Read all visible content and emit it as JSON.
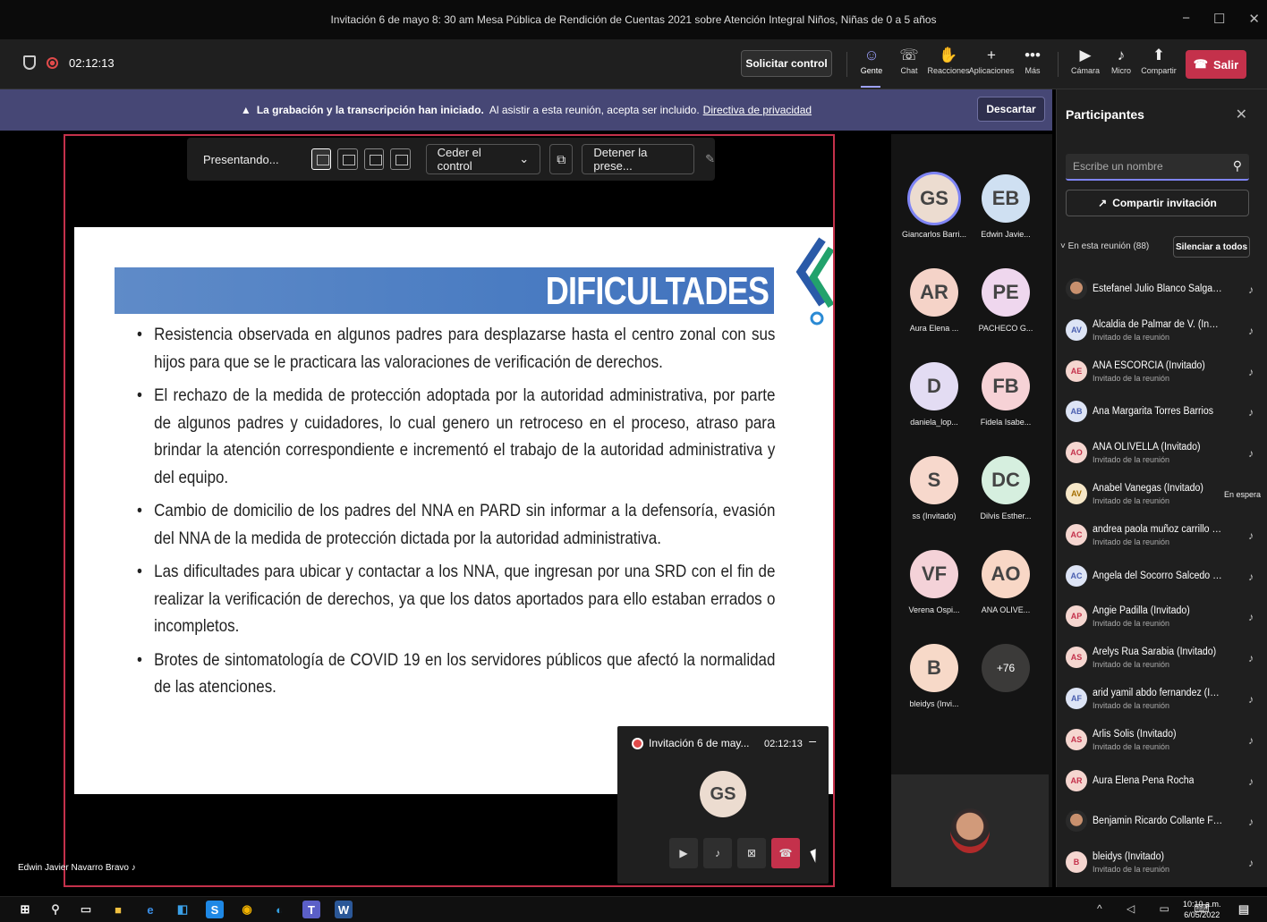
{
  "window": {
    "title": "Invitación 6 de mayo 8: 30 am Mesa Pública de Rendición de Cuentas 2021 sobre Atención Integral Niños, Niñas de 0 a 5 años"
  },
  "toolbar": {
    "timer": "02:12:13",
    "request_control": "Solicitar control",
    "people": "Gente",
    "chat": "Chat",
    "reactions": "Reacciones",
    "apps": "Aplicaciones",
    "more": "Más",
    "camera": "Cámara",
    "mic": "Micro",
    "share": "Compartir",
    "leave": "Salir"
  },
  "banner": {
    "bold": "La grabación y la transcripción han iniciado.",
    "text": "Al asistir a esta reunión, acepta ser incluido.",
    "link": "Directiva de privacidad",
    "dismiss": "Descartar"
  },
  "presenter_bar": {
    "label": "Presentando...",
    "give_control": "Ceder el control",
    "stop": "Detener la prese..."
  },
  "slide": {
    "title": "DIFICULTADES",
    "bullets": [
      "Resistencia observada en algunos padres para desplazarse hasta el centro zonal con sus hijos para que se le practicara las valoraciones de verificación de derechos.",
      "El rechazo de la medida de protección adoptada por la autoridad administrativa, por parte de algunos padres y cuidadores, lo cual genero un retroceso en el proceso, atraso para brindar la atención correspondiente e incrementó el trabajo de la autoridad administrativa y del equipo.",
      "Cambio de domicilio de los padres del NNA en PARD sin informar a la defensoría, evasión del NNA de la medida de protección dictada por la autoridad administrativa.",
      "Las dificultades para ubicar y contactar a los NNA, que ingresan por una SRD con el fin de realizar la verificación de derechos, ya que los datos aportados para ello estaban errados o incompletos.",
      "Brotes de sintomatología de COVID 19 en los servidores públicos que afectó la normalidad de las atenciones."
    ]
  },
  "presenter_name": "Edwin Javier Navarro Bravo",
  "mini": {
    "title": "Invitación 6 de may...",
    "time": "02:12:13",
    "avatar": "GS"
  },
  "gallery": [
    {
      "initials": "GS",
      "name": "Giancarlos Barri...",
      "color": "#ecdcd0"
    },
    {
      "initials": "EB",
      "name": "Edwin Javie...",
      "color": "#cfe0f2"
    },
    {
      "initials": "AR",
      "name": "Aura Elena ...",
      "color": "#f5d3c8"
    },
    {
      "initials": "PE",
      "name": "PACHECO G...",
      "color": "#efd7ee"
    },
    {
      "initials": "D",
      "name": "daniela_lop...",
      "color": "#e3dcf3"
    },
    {
      "initials": "FB",
      "name": "Fidela Isabe...",
      "color": "#f6d2d6"
    },
    {
      "initials": "S",
      "name": "ss (Invitado)",
      "color": "#f7d8cc"
    },
    {
      "initials": "DC",
      "name": "Dilvis Esther...",
      "color": "#d6efdf"
    },
    {
      "initials": "VF",
      "name": "Verena Ospi...",
      "color": "#f4d2d8"
    },
    {
      "initials": "AO",
      "name": "ANA OLIVE...",
      "color": "#f8d7c6"
    },
    {
      "initials": "B",
      "name": "bleidys (Invi...",
      "color": "#f7d9c8"
    },
    {
      "initials": "+76",
      "name": "",
      "color": "#3b3a39"
    }
  ],
  "panel": {
    "title": "Participantes",
    "search_placeholder": "Escribe un nombre",
    "share_invite": "Compartir invitación",
    "in_meeting": "En esta reunión (88)",
    "mute_all": "Silenciar a todos",
    "people": [
      {
        "initials": "",
        "name": "Estefanel Julio Blanco Salgado",
        "sub": "",
        "style": "photo"
      },
      {
        "initials": "AV",
        "name": "Alcaldia de Palmar de V. (Invitado)",
        "sub": "Invitado de la reunión",
        "style": "b"
      },
      {
        "initials": "AE",
        "name": "ANA ESCORCIA (Invitado)",
        "sub": "Invitado de la reunión",
        "style": "r"
      },
      {
        "initials": "AB",
        "name": "Ana Margarita Torres Barrios",
        "sub": "",
        "style": "b"
      },
      {
        "initials": "AO",
        "name": "ANA OLIVELLA (Invitado)",
        "sub": "Invitado de la reunión",
        "style": "r"
      },
      {
        "initials": "AV",
        "name": "Anabel Vanegas (Invitado)",
        "sub": "Invitado de la reunión",
        "style": "y",
        "status": "En espera"
      },
      {
        "initials": "AC",
        "name": "andrea paola muñoz carrillo (Inv...",
        "sub": "Invitado de la reunión",
        "style": "r"
      },
      {
        "initials": "AC",
        "name": "Angela del Socorro Salcedo Cab...",
        "sub": "",
        "style": "b"
      },
      {
        "initials": "AP",
        "name": "Angie Padilla (Invitado)",
        "sub": "Invitado de la reunión",
        "style": "r"
      },
      {
        "initials": "AS",
        "name": "Arelys Rua Sarabia (Invitado)",
        "sub": "Invitado de la reunión",
        "style": "r"
      },
      {
        "initials": "AF",
        "name": "arid yamil abdo fernandez (Invit...",
        "sub": "Invitado de la reunión",
        "style": "b"
      },
      {
        "initials": "AS",
        "name": "Arlis Solis (Invitado)",
        "sub": "Invitado de la reunión",
        "style": "r"
      },
      {
        "initials": "AR",
        "name": "Aura Elena Pena Rocha",
        "sub": "",
        "style": "r"
      },
      {
        "initials": "",
        "name": "Benjamin Ricardo Collante Fema...",
        "sub": "",
        "style": "photo"
      },
      {
        "initials": "B",
        "name": "bleidys (Invitado)",
        "sub": "Invitado de la reunión",
        "style": "r"
      }
    ]
  },
  "taskbar": {
    "time": "10:10 a.m.",
    "date": "6/05/2022"
  },
  "colors": {
    "brand": "#464775",
    "leave": "#c4314b",
    "accent": "#7f85f5"
  }
}
